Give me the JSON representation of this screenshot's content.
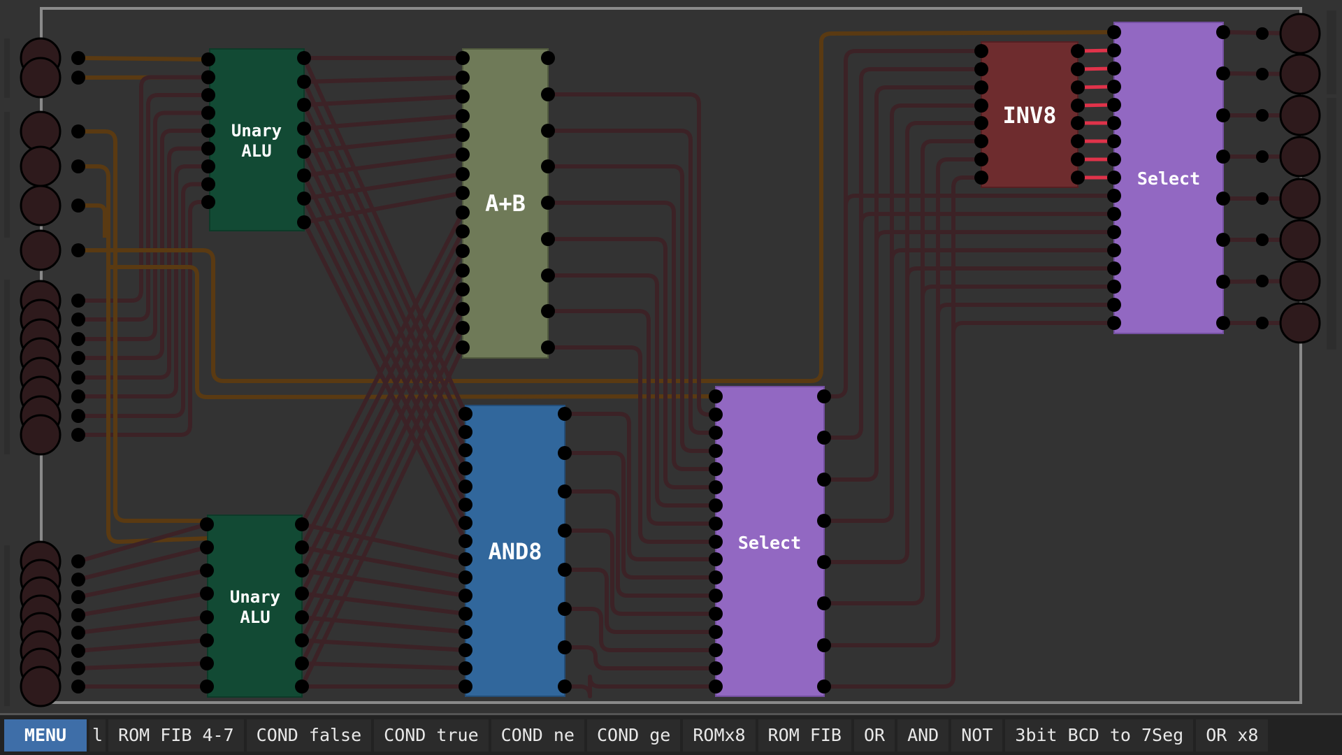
{
  "chips": [
    {
      "id": "unary-alu-top",
      "label_lines": [
        "Unary",
        "ALU"
      ],
      "color": "#124a34"
    },
    {
      "id": "unary-alu-bottom",
      "label_lines": [
        "Unary",
        "ALU"
      ],
      "color": "#124a34"
    },
    {
      "id": "adder",
      "label_lines": [
        "A+B"
      ],
      "color": "#6f7a58"
    },
    {
      "id": "and8",
      "label_lines": [
        "AND8"
      ],
      "color": "#31679c"
    },
    {
      "id": "select-mid",
      "label_lines": [
        "Select"
      ],
      "color": "#9268c2"
    },
    {
      "id": "inv8",
      "label_lines": [
        "INV8"
      ],
      "color": "#6e2c2e"
    },
    {
      "id": "select-right",
      "label_lines": [
        "Select"
      ],
      "color": "#9268c2"
    }
  ],
  "colors": {
    "background": "#333333",
    "wire": "#3c2226",
    "wire_control": "#5a3a12",
    "wire_active": "#e0334a",
    "io_pin": "#2e1a1c",
    "pin": "#000000",
    "menu_button": "#3e6ea8",
    "toolbar": "#222222"
  },
  "toolbar": {
    "menu_label": "MENU",
    "partial_label": "l",
    "items": [
      "ROM FIB 4-7",
      "COND false",
      "COND true",
      "COND ne",
      "COND ge",
      "ROMx8",
      "ROM FIB",
      "OR",
      "AND",
      "NOT",
      "3bit BCD to 7Seg",
      "OR x8"
    ]
  }
}
